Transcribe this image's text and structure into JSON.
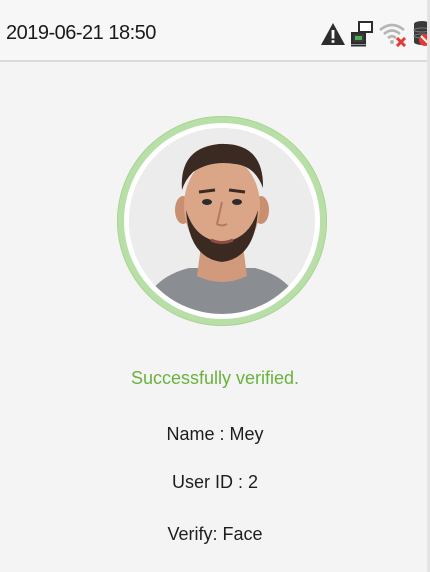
{
  "status_bar": {
    "datetime": "2019-06-21 18:50",
    "icons": [
      "warning-icon",
      "network-icon",
      "wifi-disconnected-icon",
      "database-error-icon"
    ]
  },
  "verification": {
    "message": "Successfully verified.",
    "name_line": "Name : Mey",
    "userid_line": "User ID : 2",
    "verify_line": "Verify: Face"
  },
  "colors": {
    "success": "#6ab23d",
    "ring": "#b9dfa8",
    "error_red": "#e53935"
  }
}
